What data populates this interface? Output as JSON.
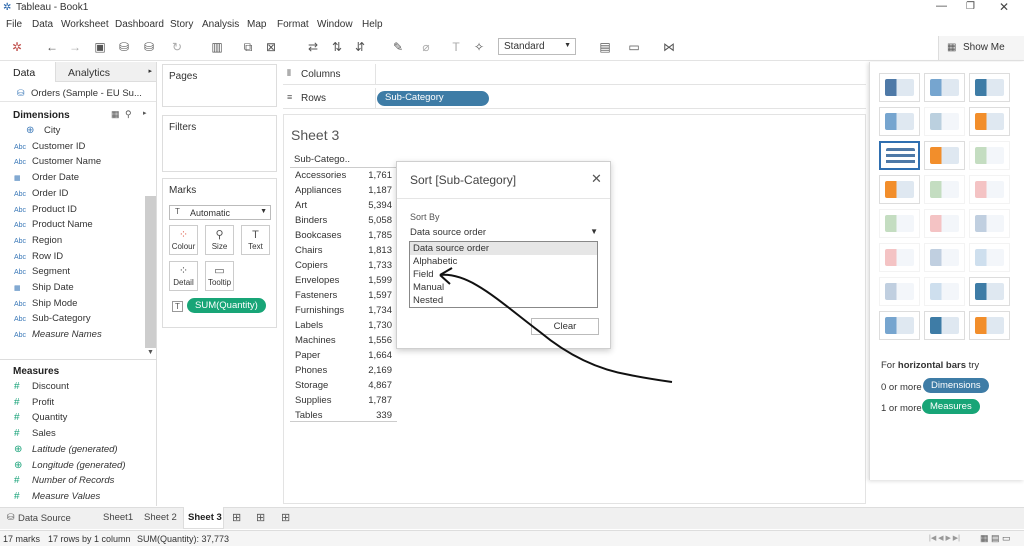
{
  "window": {
    "title": "Tableau - Book1"
  },
  "menu": [
    "File",
    "Data",
    "Worksheet",
    "Dashboard",
    "Story",
    "Analysis",
    "Map",
    "Format",
    "Window",
    "Help"
  ],
  "toolbar": {
    "fit_select": "Standard",
    "show_me": "Show Me"
  },
  "data_pane": {
    "tab_data": "Data",
    "tab_analytics": "Analytics",
    "datasource": "Orders (Sample - EU Su...",
    "dimensions_header": "Dimensions",
    "dimensions": [
      {
        "type": "geo",
        "label": "City"
      },
      {
        "type": "abc",
        "label": "Customer ID"
      },
      {
        "type": "abc",
        "label": "Customer Name"
      },
      {
        "type": "date",
        "label": "Order Date"
      },
      {
        "type": "abc",
        "label": "Order ID"
      },
      {
        "type": "abc",
        "label": "Product ID"
      },
      {
        "type": "abc",
        "label": "Product Name"
      },
      {
        "type": "abc",
        "label": "Region"
      },
      {
        "type": "abc",
        "label": "Row ID"
      },
      {
        "type": "abc",
        "label": "Segment"
      },
      {
        "type": "date",
        "label": "Ship Date"
      },
      {
        "type": "abc",
        "label": "Ship Mode"
      },
      {
        "type": "abc",
        "label": "Sub-Category"
      },
      {
        "type": "abc",
        "label": "Measure Names",
        "italic": true
      }
    ],
    "measures_header": "Measures",
    "measures": [
      {
        "type": "num",
        "label": "Discount"
      },
      {
        "type": "num",
        "label": "Profit"
      },
      {
        "type": "num",
        "label": "Quantity"
      },
      {
        "type": "num",
        "label": "Sales"
      },
      {
        "type": "geo",
        "label": "Latitude (generated)",
        "italic": true
      },
      {
        "type": "geo",
        "label": "Longitude (generated)",
        "italic": true
      },
      {
        "type": "num",
        "label": "Number of Records",
        "italic": true
      },
      {
        "type": "num",
        "label": "Measure Values",
        "italic": true
      }
    ]
  },
  "cards": {
    "pages": "Pages",
    "filters": "Filters",
    "marks": "Marks",
    "mark_type": "Automatic",
    "mark_buttons": [
      "Colour",
      "Size",
      "Text",
      "Detail",
      "Tooltip"
    ],
    "marks_pill": "SUM(Quantity)"
  },
  "shelves": {
    "columns": "Columns",
    "rows": "Rows",
    "rows_pill": "Sub-Category"
  },
  "sheet": {
    "title": "Sheet 3",
    "header": "Sub-Catego..",
    "rows": [
      {
        "c": "Accessories",
        "v": "1,761"
      },
      {
        "c": "Appliances",
        "v": "1,187"
      },
      {
        "c": "Art",
        "v": "5,394"
      },
      {
        "c": "Binders",
        "v": "5,058"
      },
      {
        "c": "Bookcases",
        "v": "1,785"
      },
      {
        "c": "Chairs",
        "v": "1,813"
      },
      {
        "c": "Copiers",
        "v": "1,733"
      },
      {
        "c": "Envelopes",
        "v": "1,599"
      },
      {
        "c": "Fasteners",
        "v": "1,597"
      },
      {
        "c": "Furnishings",
        "v": "1,734"
      },
      {
        "c": "Labels",
        "v": "1,730"
      },
      {
        "c": "Machines",
        "v": "1,556"
      },
      {
        "c": "Paper",
        "v": "1,664"
      },
      {
        "c": "Phones",
        "v": "2,169"
      },
      {
        "c": "Storage",
        "v": "4,867"
      },
      {
        "c": "Supplies",
        "v": "1,787"
      },
      {
        "c": "Tables",
        "v": "339"
      }
    ]
  },
  "dialog": {
    "title": "Sort [Sub-Category]",
    "sort_by_label": "Sort By",
    "selected": "Data source order",
    "options": [
      "Data source order",
      "Alphabetic",
      "Field",
      "Manual",
      "Nested"
    ],
    "clear": "Clear"
  },
  "showme": {
    "hint_prefix": "For ",
    "hint_bold": "horizontal bars",
    "hint_suffix": " try",
    "line1_prefix": "0 or more",
    "line1_pill": "Dimensions",
    "line2_prefix": "1 or more",
    "line2_pill": "Measures"
  },
  "tabs": {
    "datasource": "Data Source",
    "sheets": [
      "Sheet1",
      "Sheet 2",
      "Sheet 3"
    ]
  },
  "status": {
    "marks": "17 marks",
    "rows": "17 rows by 1 column",
    "sum": "SUM(Quantity): 37,773"
  },
  "colors": {
    "pill_blue": "#3e7ca6",
    "pill_green": "#18a577",
    "accent": "#1f77b4"
  }
}
